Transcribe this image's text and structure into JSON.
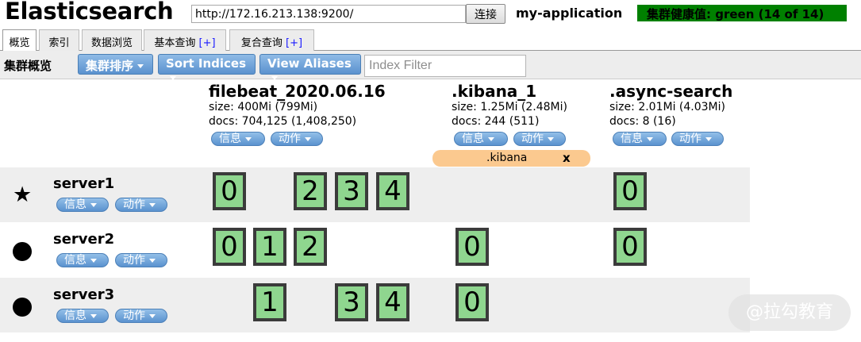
{
  "header": {
    "app_title": "Elasticsearch",
    "url_value": "http://172.16.213.138:9200/",
    "connect_label": "连接",
    "cluster_name": "my-application",
    "health_text": "集群健康值: green (14 of 14)",
    "health_color": "#008000"
  },
  "tabs": [
    {
      "label": "概览",
      "plus": ""
    },
    {
      "label": "索引",
      "plus": ""
    },
    {
      "label": "数据浏览",
      "plus": ""
    },
    {
      "label": "基本查询 ",
      "plus": "[+]"
    },
    {
      "label": "复合查询 ",
      "plus": "[+]"
    }
  ],
  "toolbar": {
    "title": "集群概览",
    "sort_cluster_label": "集群排序",
    "sort_indices_label": "Sort Indices",
    "view_aliases_label": "View Aliases",
    "index_filter_placeholder": "Index Filter"
  },
  "indices": [
    {
      "name": "filebeat_2020.06.16",
      "size": "size: 400Mi (799Mi)",
      "docs": "docs: 704,125 (1,408,250)",
      "info_label": "信息",
      "action_label": "动作"
    },
    {
      "name": ".kibana_1",
      "size": "size: 1.25Mi (2.48Mi)",
      "docs": "docs: 244 (511)",
      "info_label": "信息",
      "action_label": "动作"
    },
    {
      "name": ".async-search",
      "size": "size: 2.01Mi (4.03Mi)",
      "docs": "docs: 8 (16)",
      "info_label": "信息",
      "action_label": "动作"
    }
  ],
  "alias": {
    "name": ".kibana",
    "close_label": "x"
  },
  "nodes": [
    {
      "name": "server1",
      "icon": "star-icon",
      "icon_glyph": "★",
      "info_label": "信息",
      "action_label": "动作",
      "shards": [
        "0",
        "2",
        "3",
        "4",
        "0"
      ]
    },
    {
      "name": "server2",
      "icon": "circle-icon",
      "icon_glyph": "",
      "info_label": "信息",
      "action_label": "动作",
      "shards": [
        "0",
        "1",
        "2",
        "0",
        "0"
      ]
    },
    {
      "name": "server3",
      "icon": "circle-icon",
      "icon_glyph": "",
      "info_label": "信息",
      "action_label": "动作",
      "shards": [
        "1",
        "3",
        "4",
        "0"
      ]
    }
  ],
  "watermark": "@拉勾教育",
  "colors": {
    "shard_fill": "#8fd68f",
    "alias_fill": "#fbc98f",
    "button_blue": "#5b92cf"
  }
}
